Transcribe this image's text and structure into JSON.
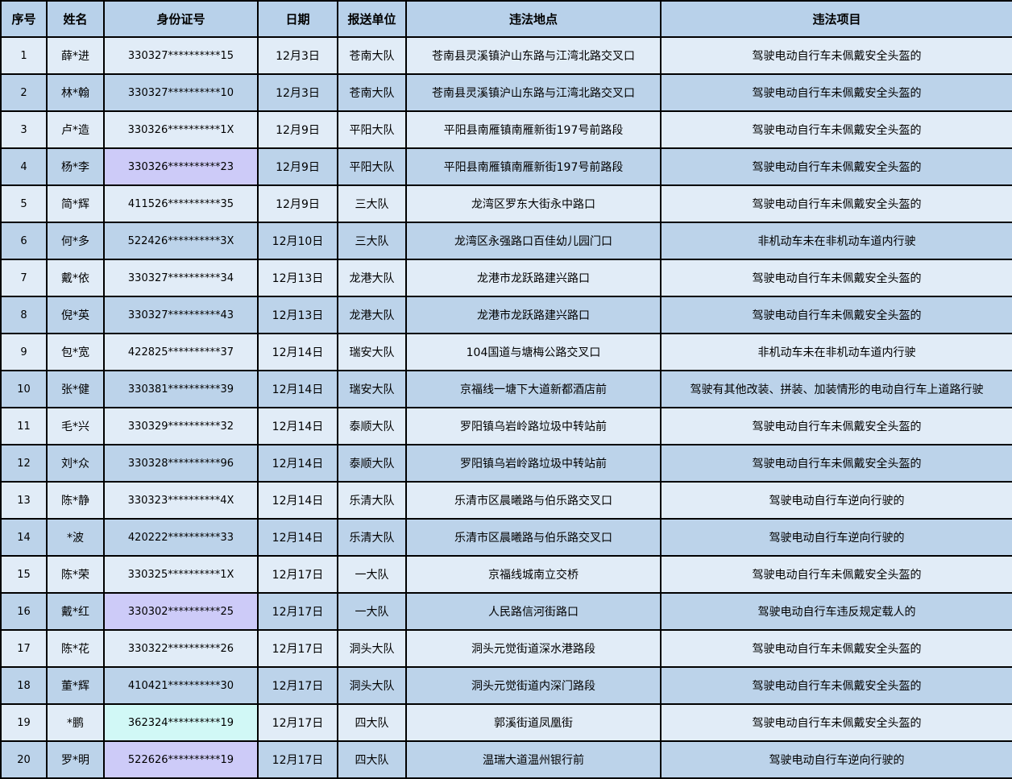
{
  "headers": [
    "序号",
    "姓名",
    "身份证号",
    "日期",
    "报送单位",
    "违法地点",
    "违法项目"
  ],
  "rows": [
    {
      "no": "1",
      "name": "薛*进",
      "id": "330327**********15",
      "date": "12月3日",
      "unit": "苍南大队",
      "place": "苍南县灵溪镇沪山东路与江湾北路交叉口",
      "violation": "驾驶电动自行车未佩戴安全头盔的",
      "id_highlight": ""
    },
    {
      "no": "2",
      "name": "林*翰",
      "id": "330327**********10",
      "date": "12月3日",
      "unit": "苍南大队",
      "place": "苍南县灵溪镇沪山东路与江湾北路交叉口",
      "violation": "驾驶电动自行车未佩戴安全头盔的",
      "id_highlight": ""
    },
    {
      "no": "3",
      "name": "卢*造",
      "id": "330326**********1X",
      "date": "12月9日",
      "unit": "平阳大队",
      "place": "平阳县南雁镇南雁新街197号前路段",
      "violation": "驾驶电动自行车未佩戴安全头盔的",
      "id_highlight": ""
    },
    {
      "no": "4",
      "name": "杨*李",
      "id": "330326**********23",
      "date": "12月9日",
      "unit": "平阳大队",
      "place": "平阳县南雁镇南雁新街197号前路段",
      "violation": "驾驶电动自行车未佩戴安全头盔的",
      "id_highlight": "purple"
    },
    {
      "no": "5",
      "name": "简*辉",
      "id": "411526**********35",
      "date": "12月9日",
      "unit": "三大队",
      "place": "龙湾区罗东大街永中路口",
      "violation": "驾驶电动自行车未佩戴安全头盔的",
      "id_highlight": ""
    },
    {
      "no": "6",
      "name": "何*多",
      "id": "522426**********3X",
      "date": "12月10日",
      "unit": "三大队",
      "place": "龙湾区永强路口百佳幼儿园门口",
      "violation": "非机动车未在非机动车道内行驶",
      "id_highlight": ""
    },
    {
      "no": "7",
      "name": "戴*依",
      "id": "330327**********34",
      "date": "12月13日",
      "unit": "龙港大队",
      "place": "龙港市龙跃路建兴路口",
      "violation": "驾驶电动自行车未佩戴安全头盔的",
      "id_highlight": ""
    },
    {
      "no": "8",
      "name": "倪*英",
      "id": "330327**********43",
      "date": "12月13日",
      "unit": "龙港大队",
      "place": "龙港市龙跃路建兴路口",
      "violation": "驾驶电动自行车未佩戴安全头盔的",
      "id_highlight": ""
    },
    {
      "no": "9",
      "name": "包*宽",
      "id": "422825**********37",
      "date": "12月14日",
      "unit": "瑞安大队",
      "place": "104国道与塘梅公路交叉口",
      "violation": "非机动车未在非机动车道内行驶",
      "id_highlight": ""
    },
    {
      "no": "10",
      "name": "张*健",
      "id": "330381**********39",
      "date": "12月14日",
      "unit": "瑞安大队",
      "place": "京福线一塘下大道新都酒店前",
      "violation": "驾驶有其他改装、拼装、加装情形的电动自行车上道路行驶",
      "id_highlight": ""
    },
    {
      "no": "11",
      "name": "毛*兴",
      "id": "330329**********32",
      "date": "12月14日",
      "unit": "泰顺大队",
      "place": "罗阳镇乌岩岭路垃圾中转站前",
      "violation": "驾驶电动自行车未佩戴安全头盔的",
      "id_highlight": ""
    },
    {
      "no": "12",
      "name": "刘*众",
      "id": "330328**********96",
      "date": "12月14日",
      "unit": "泰顺大队",
      "place": "罗阳镇乌岩岭路垃圾中转站前",
      "violation": "驾驶电动自行车未佩戴安全头盔的",
      "id_highlight": ""
    },
    {
      "no": "13",
      "name": "陈*静",
      "id": "330323**********4X",
      "date": "12月14日",
      "unit": "乐清大队",
      "place": "乐清市区晨曦路与伯乐路交叉口",
      "violation": "驾驶电动自行车逆向行驶的",
      "id_highlight": ""
    },
    {
      "no": "14",
      "name": "*波",
      "id": "420222**********33",
      "date": "12月14日",
      "unit": "乐清大队",
      "place": "乐清市区晨曦路与伯乐路交叉口",
      "violation": "驾驶电动自行车逆向行驶的",
      "id_highlight": ""
    },
    {
      "no": "15",
      "name": "陈*荣",
      "id": "330325**********1X",
      "date": "12月17日",
      "unit": "一大队",
      "place": "京福线城南立交桥",
      "violation": "驾驶电动自行车未佩戴安全头盔的",
      "id_highlight": ""
    },
    {
      "no": "16",
      "name": "戴*红",
      "id": "330302**********25",
      "date": "12月17日",
      "unit": "一大队",
      "place": "人民路信河街路口",
      "violation": "驾驶电动自行车违反规定载人的",
      "id_highlight": "purple"
    },
    {
      "no": "17",
      "name": "陈*花",
      "id": "330322**********26",
      "date": "12月17日",
      "unit": "洞头大队",
      "place": "洞头元觉街道深水港路段",
      "violation": "驾驶电动自行车未佩戴安全头盔的",
      "id_highlight": ""
    },
    {
      "no": "18",
      "name": "董*辉",
      "id": "410421**********30",
      "date": "12月17日",
      "unit": "洞头大队",
      "place": "洞头元觉街道内深门路段",
      "violation": "驾驶电动自行车未佩戴安全头盔的",
      "id_highlight": ""
    },
    {
      "no": "19",
      "name": "*鹏",
      "id": "362324**********19",
      "date": "12月17日",
      "unit": "四大队",
      "place": "郭溪街道凤凰街",
      "violation": "驾驶电动自行车未佩戴安全头盔的",
      "id_highlight": "cyan"
    },
    {
      "no": "20",
      "name": "罗*明",
      "id": "522626**********19",
      "date": "12月17日",
      "unit": "四大队",
      "place": "温瑞大道温州银行前",
      "violation": "驾驶电动自行车逆向行驶的",
      "id_highlight": "purple"
    }
  ]
}
